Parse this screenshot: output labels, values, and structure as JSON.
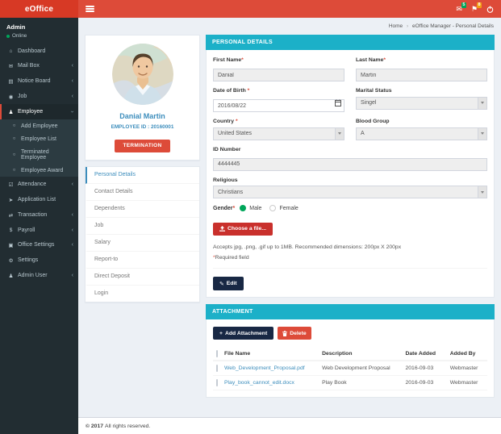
{
  "header": {
    "logo_text": "eOffice",
    "mail_badge": "5",
    "flag_badge": "8"
  },
  "breadcrumb": {
    "home": "Home",
    "sep": "›",
    "current": "eOffice Manager - Personal Details"
  },
  "sidebar": {
    "user_name": "Admin",
    "user_status": "Online",
    "items": [
      {
        "icon": "⌂",
        "label": "Dashboard",
        "chevron": ""
      },
      {
        "icon": "✉",
        "label": "Mail Box",
        "chevron": "‹"
      },
      {
        "icon": "▤",
        "label": "Notice Board",
        "chevron": "‹"
      },
      {
        "icon": "◉",
        "label": "Job",
        "chevron": "‹"
      },
      {
        "icon": "♟",
        "label": "Employee",
        "chevron": "‹"
      },
      {
        "icon": "☑",
        "label": "Attendance",
        "chevron": "‹"
      },
      {
        "icon": "➤",
        "label": "Application List",
        "chevron": ""
      },
      {
        "icon": "⇄",
        "label": "Transaction",
        "chevron": "‹"
      },
      {
        "icon": "$",
        "label": "Payroll",
        "chevron": "‹"
      },
      {
        "icon": "▣",
        "label": "Office Settings",
        "chevron": "‹"
      },
      {
        "icon": "⚙",
        "label": "Settings",
        "chevron": ""
      },
      {
        "icon": "♟",
        "label": "Admin User",
        "chevron": "‹"
      }
    ],
    "employee_submenu": [
      {
        "icon": "○",
        "label": "Add Employee"
      },
      {
        "icon": "○",
        "label": "Employee List"
      },
      {
        "icon": "○",
        "label": "Terminated Employee"
      },
      {
        "icon": "○",
        "label": "Employee Award"
      }
    ]
  },
  "profile": {
    "name": "Danial Martin",
    "employee_id": "EMPLOYEE ID : 20160001",
    "termination_label": "TERMINATION",
    "menu": [
      {
        "label": "Personal Details"
      },
      {
        "label": "Contact Details"
      },
      {
        "label": "Dependents"
      },
      {
        "label": "Job"
      },
      {
        "label": "Salary"
      },
      {
        "label": "Report-to"
      },
      {
        "label": "Direct Deposit"
      },
      {
        "label": "Login"
      }
    ]
  },
  "personal": {
    "title": "PERSONAL DETAILS",
    "first_name": {
      "label": "First Name",
      "star": "*",
      "value": "Danial"
    },
    "last_name": {
      "label": "Last Name",
      "star": "*",
      "value": "Martin"
    },
    "dob": {
      "label": "Date of Birth ",
      "star": "*",
      "value": "2016/08/22"
    },
    "marital": {
      "label": "Marital Status",
      "star": "",
      "value": "Singel"
    },
    "country": {
      "label": "Country ",
      "star": "*",
      "value": "United States"
    },
    "blood": {
      "label": "Blood Group",
      "star": "",
      "value": "A"
    },
    "id_number": {
      "label": "ID Number",
      "star": "",
      "value": "4444445"
    },
    "religious": {
      "label": "Religious",
      "star": "",
      "value": "Christians"
    },
    "gender": {
      "label": "Gender",
      "star": "*",
      "male": "Male",
      "female": "Female",
      "selected": "Male"
    },
    "choose_file_label": "Choose a file...",
    "upload_help": "Accepts jpg, .png, .gif up to 1MB. Recommended dimensions: 200px X 200px",
    "required_star": "*",
    "required_note": "Required field",
    "edit_label": "Edit"
  },
  "attachment": {
    "title": "ATTACHMENT",
    "add_label": "Add Attachment",
    "delete_label": "Delete",
    "headers": {
      "file": "File Name",
      "desc": "Description",
      "date": "Date Added",
      "by": "Added By"
    },
    "rows": [
      {
        "file": "Web_Development_Proposal.pdf",
        "desc": "Web Development Proposal",
        "date": "2016-09-03",
        "by": "Webmaster"
      },
      {
        "file": "Play_book_cannot_edit.docx",
        "desc": "Play Book",
        "date": "2016-09-03",
        "by": "Webmaster"
      }
    ]
  },
  "footer": {
    "year": "© 2017",
    "text": "All rights reserved."
  },
  "icons": {
    "mail": "✉",
    "flag": "⚑",
    "edit": "✎",
    "plus": "+"
  },
  "colors": {
    "header_red": "#dd4b39",
    "logo_red": "#d73925",
    "sidebar_dark": "#222d32",
    "panel_teal": "#1cb0c8",
    "link_blue": "#3c8dbc",
    "navy_button": "#182844",
    "danger_red": "#c9302c",
    "success_green": "#00a65a",
    "badge_orange": "#f39c12"
  }
}
